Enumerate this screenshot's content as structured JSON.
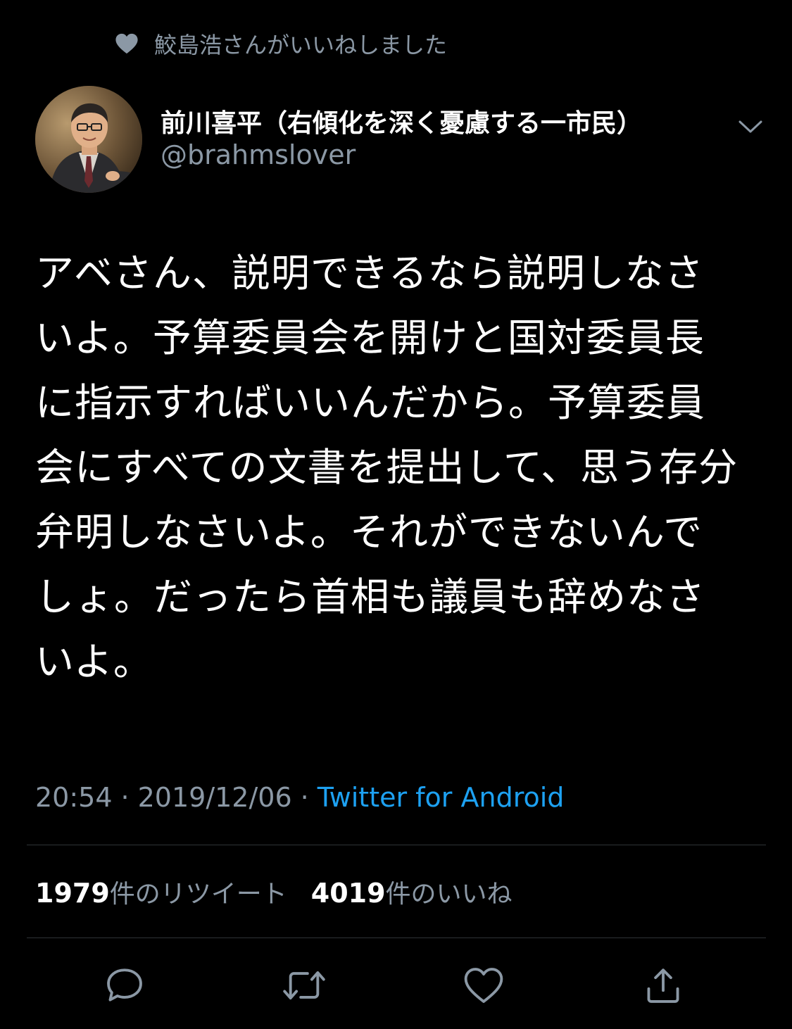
{
  "social_context": {
    "icon": "heart-icon",
    "text": "鮫島浩さんがいいねしました"
  },
  "author": {
    "display_name": "前川喜平（右傾化を深く憂慮する一市民）",
    "handle": "@brahmslover",
    "avatar_icon": "profile-photo",
    "menu_icon": "chevron-down-icon"
  },
  "tweet": {
    "text": "アベさん、説明できるなら説明しなさいよ。予算委員会を開けと国対委員長に指示すればいいんだから。予算委員会にすべての文書を提出して、思う存分弁明しなさいよ。それができないんでしょ。だったら首相も議員も辞めなさいよ。"
  },
  "meta": {
    "time": "20:54",
    "separator": "·",
    "date": "2019/12/06",
    "source": "Twitter for Android"
  },
  "stats": {
    "retweets_count": "1979",
    "retweets_label": "件のリツイート",
    "likes_count": "4019",
    "likes_label": "件のいいね"
  },
  "actions": [
    {
      "name": "reply",
      "icon": "reply-icon"
    },
    {
      "name": "retweet",
      "icon": "retweet-icon"
    },
    {
      "name": "like",
      "icon": "heart-outline-icon"
    },
    {
      "name": "share",
      "icon": "share-icon"
    }
  ],
  "colors": {
    "background": "#000000",
    "text_primary": "#ffffff",
    "text_secondary": "#8b98a5",
    "link": "#1da1f2",
    "divider": "#2f3336"
  }
}
